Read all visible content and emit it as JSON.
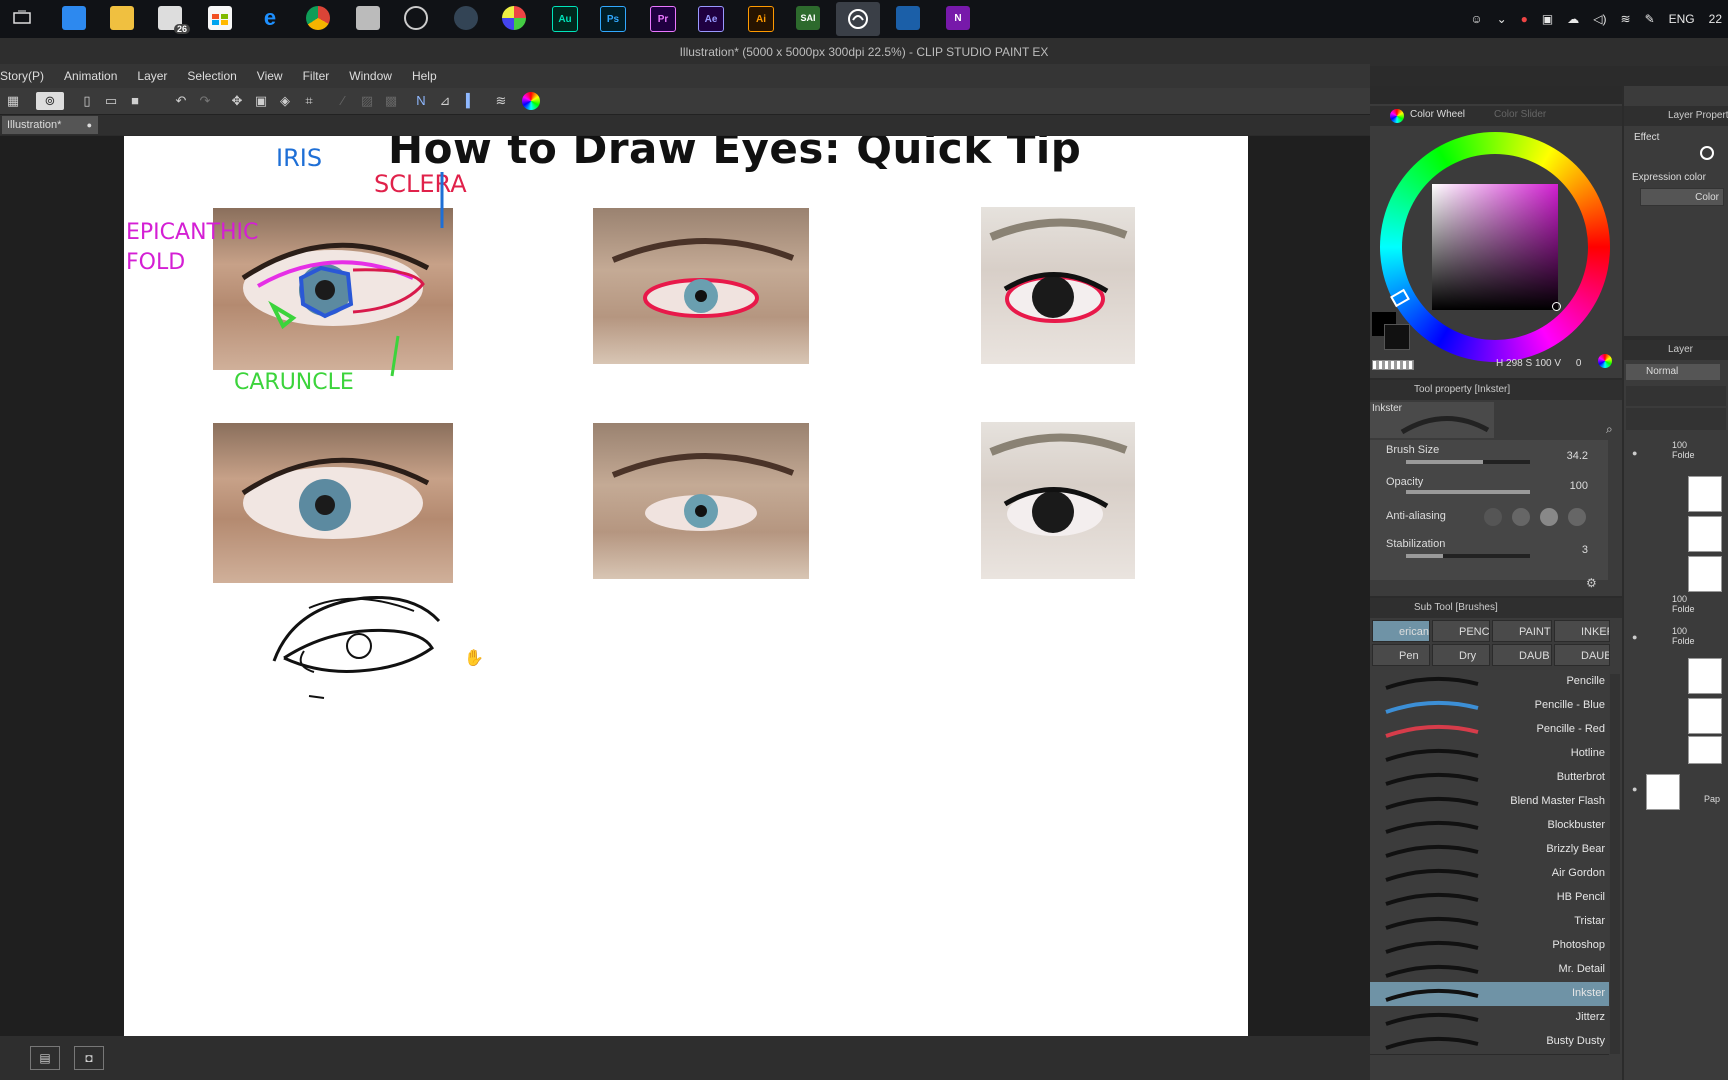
{
  "taskbar": {
    "apps": [
      {
        "name": "task-view",
        "label": ""
      },
      {
        "name": "calculator",
        "label": ""
      },
      {
        "name": "file-explorer",
        "label": ""
      },
      {
        "name": "mail",
        "label": ""
      },
      {
        "name": "store",
        "label": ""
      },
      {
        "name": "edge",
        "label": "e"
      },
      {
        "name": "chrome",
        "label": ""
      },
      {
        "name": "app-7",
        "label": ""
      },
      {
        "name": "obs",
        "label": ""
      },
      {
        "name": "app-9",
        "label": ""
      },
      {
        "name": "app-10",
        "label": ""
      },
      {
        "name": "audition",
        "label": "Au"
      },
      {
        "name": "photoshop",
        "label": "Ps"
      },
      {
        "name": "premiere",
        "label": "Pr"
      },
      {
        "name": "after-effects",
        "label": "Ae"
      },
      {
        "name": "illustrator",
        "label": "Ai"
      },
      {
        "name": "sai",
        "label": "SAI"
      },
      {
        "name": "clip-studio",
        "label": ""
      },
      {
        "name": "app-18",
        "label": ""
      },
      {
        "name": "onenote",
        "label": "N"
      }
    ],
    "mail_badge": "26",
    "lang": "ENG",
    "clock": "22"
  },
  "window": {
    "title": "Illustration* (5000 x 5000px 300dpi 22.5%)  - CLIP STUDIO PAINT EX"
  },
  "menu": [
    "Story(P)",
    "Animation",
    "Layer",
    "Selection",
    "View",
    "Filter",
    "Window",
    "Help"
  ],
  "doc_tab": "Illustration*",
  "canvas": {
    "title": "How to Draw Eyes: Quick Tip",
    "annotations": {
      "iris": "IRIS",
      "sclera": "SCLERA",
      "epicanthic": "EPICANTHIC",
      "fold": "FOLD",
      "caruncle": "CARUNCLE"
    }
  },
  "color_wheel": {
    "tab1": "Color Wheel",
    "tab2": "Color Slider",
    "h": "298",
    "s": "100",
    "v": "0",
    "h_label": "H",
    "s_label": "S",
    "v_label": "V",
    "hue_color": "#d21fd2"
  },
  "tool_property": {
    "header": "Tool property [Inkster]",
    "preset": "Inkster",
    "brush_size_label": "Brush Size",
    "brush_size": "34.2",
    "brush_size_fraction": 0.62,
    "opacity_label": "Opacity",
    "opacity": "100",
    "opacity_fraction": 1.0,
    "aa_label": "Anti-aliasing",
    "stab_label": "Stabilization",
    "stabilization": "3",
    "stab_fraction": 0.3
  },
  "sub_tool": {
    "header": "Sub Tool [Brushes]",
    "tabs": [
      "ericani",
      "PENC",
      "PAINT",
      "INKER",
      "Pen",
      "Dry",
      "DAUB",
      "DAUB"
    ],
    "brushes": [
      "Pencille",
      "Pencille - Blue",
      "Pencille - Red",
      "Hotline",
      "Butterbrot",
      "Blend Master Flash",
      "Blockbuster",
      "Brizzly Bear",
      "Air Gordon",
      "HB Pencil",
      "Tristar",
      "Photoshop",
      "Mr. Detail",
      "Inkster",
      "Jitterz",
      "Busty Dusty"
    ],
    "selected": "Inkster"
  },
  "layer_property": {
    "header": "Layer Property",
    "effect": "Effect",
    "expression": "Expression color",
    "color_button": "Color"
  },
  "layer_panel": {
    "header": "Layer",
    "blend_mode": "Normal",
    "rows": [
      {
        "pct": "100",
        "name": "Folde"
      },
      {
        "pct": "100",
        "name": "Folde"
      },
      {
        "pct": "100",
        "name": "Folde"
      },
      {
        "pct": "",
        "name": "Pap"
      }
    ]
  }
}
